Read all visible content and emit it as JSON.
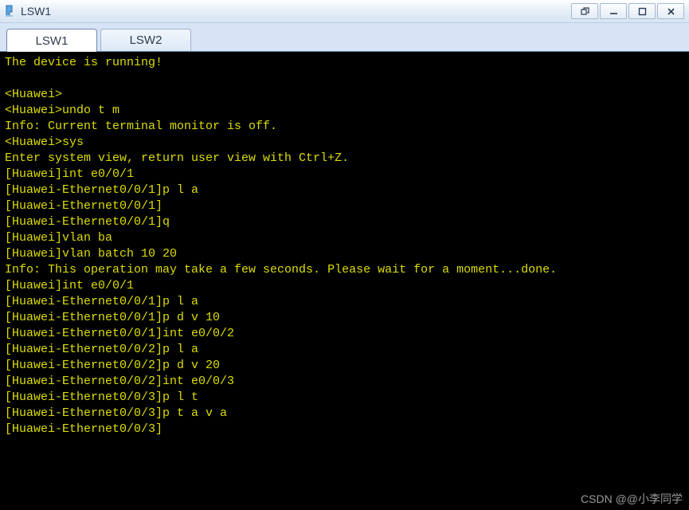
{
  "window": {
    "title": "LSW1",
    "controls": {
      "pop": "pop-out",
      "min": "minimize",
      "max": "maximize",
      "close": "close"
    }
  },
  "tabs": [
    {
      "label": "LSW1",
      "active": true
    },
    {
      "label": "LSW2",
      "active": false
    }
  ],
  "terminal": {
    "lines": [
      "The device is running!",
      "",
      "<Huawei>",
      "<Huawei>undo t m",
      "Info: Current terminal monitor is off.",
      "<Huawei>sys",
      "Enter system view, return user view with Ctrl+Z.",
      "[Huawei]int e0/0/1",
      "[Huawei-Ethernet0/0/1]p l a",
      "[Huawei-Ethernet0/0/1]",
      "[Huawei-Ethernet0/0/1]q",
      "[Huawei]vlan ba",
      "[Huawei]vlan batch 10 20",
      "Info: This operation may take a few seconds. Please wait for a moment...done.",
      "[Huawei]int e0/0/1",
      "[Huawei-Ethernet0/0/1]p l a",
      "[Huawei-Ethernet0/0/1]p d v 10",
      "[Huawei-Ethernet0/0/1]int e0/0/2",
      "[Huawei-Ethernet0/0/2]p l a",
      "[Huawei-Ethernet0/0/2]p d v 20",
      "[Huawei-Ethernet0/0/2]int e0/0/3",
      "[Huawei-Ethernet0/0/3]p l t",
      "[Huawei-Ethernet0/0/3]p t a v a",
      "[Huawei-Ethernet0/0/3]"
    ]
  },
  "watermark": "CSDN @@小李同学"
}
